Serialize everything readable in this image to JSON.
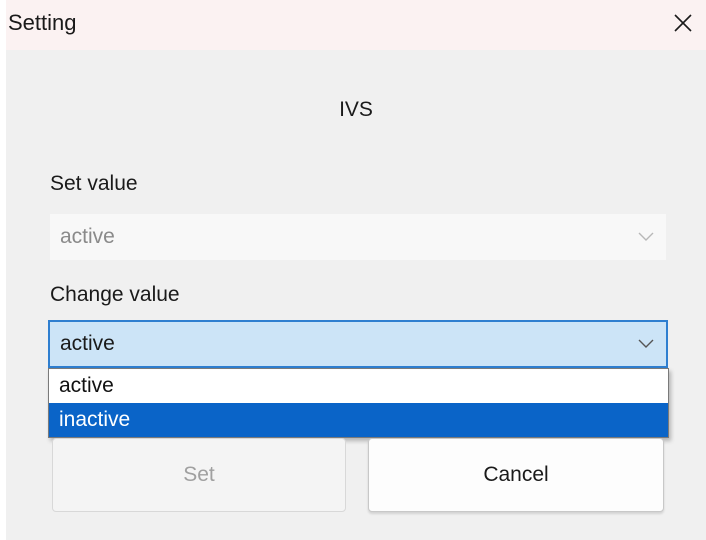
{
  "window": {
    "title": "Setting",
    "close_icon": "close-icon"
  },
  "dialog": {
    "heading": "IVS",
    "set_value": {
      "label": "Set value",
      "value": "active",
      "disabled": true
    },
    "change_value": {
      "label": "Change value",
      "value": "active",
      "options": [
        "active",
        "inactive"
      ],
      "highlighted_option": "inactive"
    }
  },
  "buttons": {
    "set_label": "Set",
    "cancel_label": "Cancel"
  },
  "colors": {
    "accent": "#0a64c8",
    "select_focus_bg": "#cce4f7",
    "titlebar_bg": "#fbf2f2"
  }
}
